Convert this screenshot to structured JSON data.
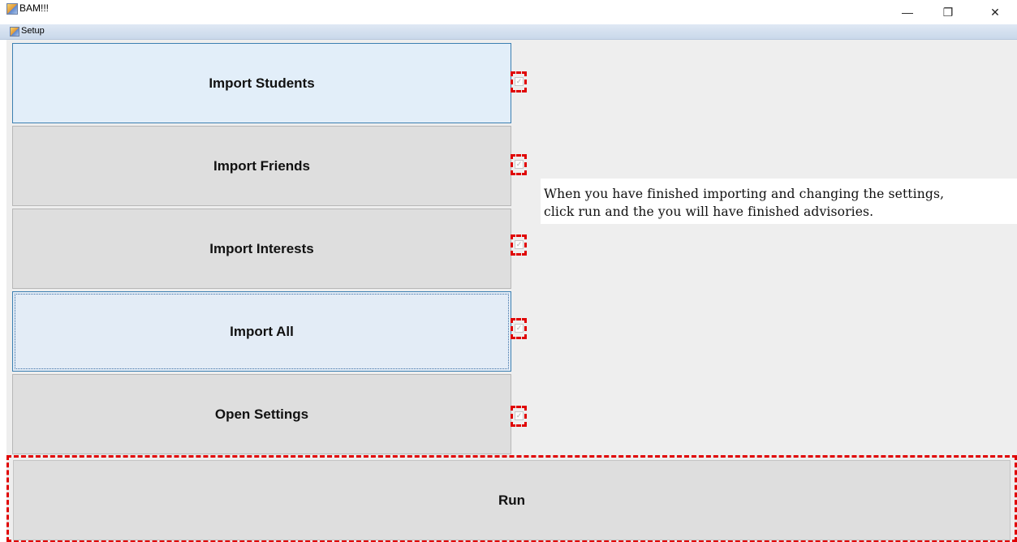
{
  "window": {
    "title": "BAM!!!",
    "minimize_glyph": "—",
    "restore_glyph": "❐",
    "close_glyph": "✕"
  },
  "menubar": {
    "setup_label": "Setup"
  },
  "buttons": {
    "import_students": "Import Students",
    "import_friends": "Import Friends",
    "import_interests": "Import Interests",
    "import_all": "Import All",
    "open_settings": "Open Settings",
    "run": "Run"
  },
  "checkboxes": {
    "students_checked": false,
    "friends_checked": false,
    "interests_checked": false,
    "all_checked": false,
    "settings_checked": false
  },
  "info": {
    "line1": "When you have finished importing and changing the settings,",
    "line2": "click run and the you will have finished advisories."
  },
  "colors": {
    "highlight_dash": "#e00000",
    "button_bg": "#dedede",
    "hover_bg": "#e2eef9",
    "panel_bg": "#eeeeee"
  }
}
